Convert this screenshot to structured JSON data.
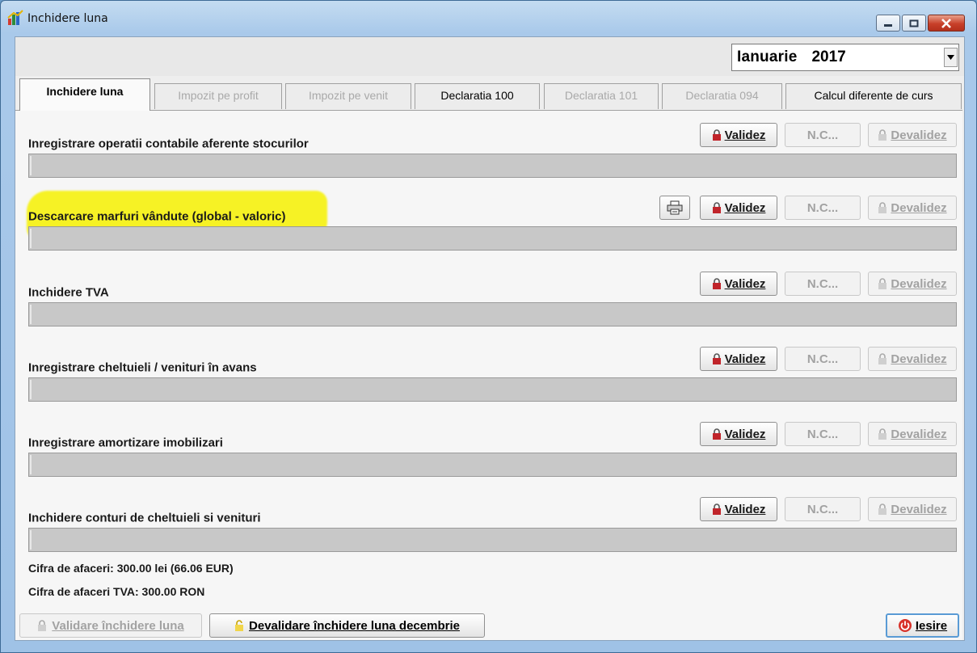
{
  "window": {
    "title": "Inchidere luna",
    "icon": "chart-icon"
  },
  "period": {
    "month": "Ianuarie",
    "year": "2017"
  },
  "tabs": [
    {
      "label": "Inchidere luna",
      "active": true,
      "enabled": true
    },
    {
      "label": "Impozit pe profit",
      "enabled": false
    },
    {
      "label": "Impozit pe venit",
      "enabled": false
    },
    {
      "label": "Declaratia 100",
      "enabled": true
    },
    {
      "label": "Declaratia 101",
      "enabled": false
    },
    {
      "label": "Declaratia 094",
      "enabled": false
    },
    {
      "label": "Calcul diferente de curs",
      "enabled": true
    }
  ],
  "buttons": {
    "validate": "Validez",
    "nc": "N.C...",
    "devalidate": "Devalidez"
  },
  "sections": [
    {
      "label": "Inregistrare operatii contabile aferente stocurilor"
    },
    {
      "label": "Descarcare marfuri vândute (global - valoric)",
      "highlighted": true,
      "has_print": true
    },
    {
      "label": "Inchidere TVA"
    },
    {
      "label": "Inregistrare cheltuieli / venituri în avans"
    },
    {
      "label": "Inregistrare amortizare imobilizari"
    },
    {
      "label": "Inchidere conturi de cheltuieli si venituri"
    }
  ],
  "info": {
    "turnover": "Cifra de afaceri: 300.00 lei (66.06 EUR)",
    "turnover_vat": "Cifra de afaceri TVA: 300.00 RON"
  },
  "footer": {
    "validate_close": "Validare închidere luna",
    "devalidate_close": "Devalidare închidere luna decembrie",
    "exit": "Iesire"
  },
  "colors": {
    "highlight": "#f6f21a",
    "lock_red": "#c0242a",
    "exit_red": "#d8322a"
  }
}
